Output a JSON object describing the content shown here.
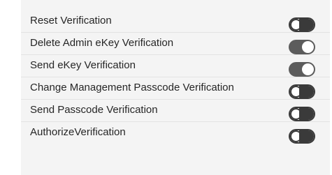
{
  "settings": {
    "items": [
      {
        "label": "Reset Verification",
        "enabled": false
      },
      {
        "label": "Delete Admin eKey Verification",
        "enabled": true
      },
      {
        "label": "Send eKey Verification",
        "enabled": true
      },
      {
        "label": "Change Management Passcode Verification",
        "enabled": false
      },
      {
        "label": "Send Passcode Verification",
        "enabled": false
      },
      {
        "label": "AuthorizeVerification",
        "enabled": false
      }
    ]
  },
  "colors": {
    "panel_background": "#f4f4f4",
    "toggle_on": "#5c5c5c",
    "toggle_off_border": "#3a3a3a"
  }
}
